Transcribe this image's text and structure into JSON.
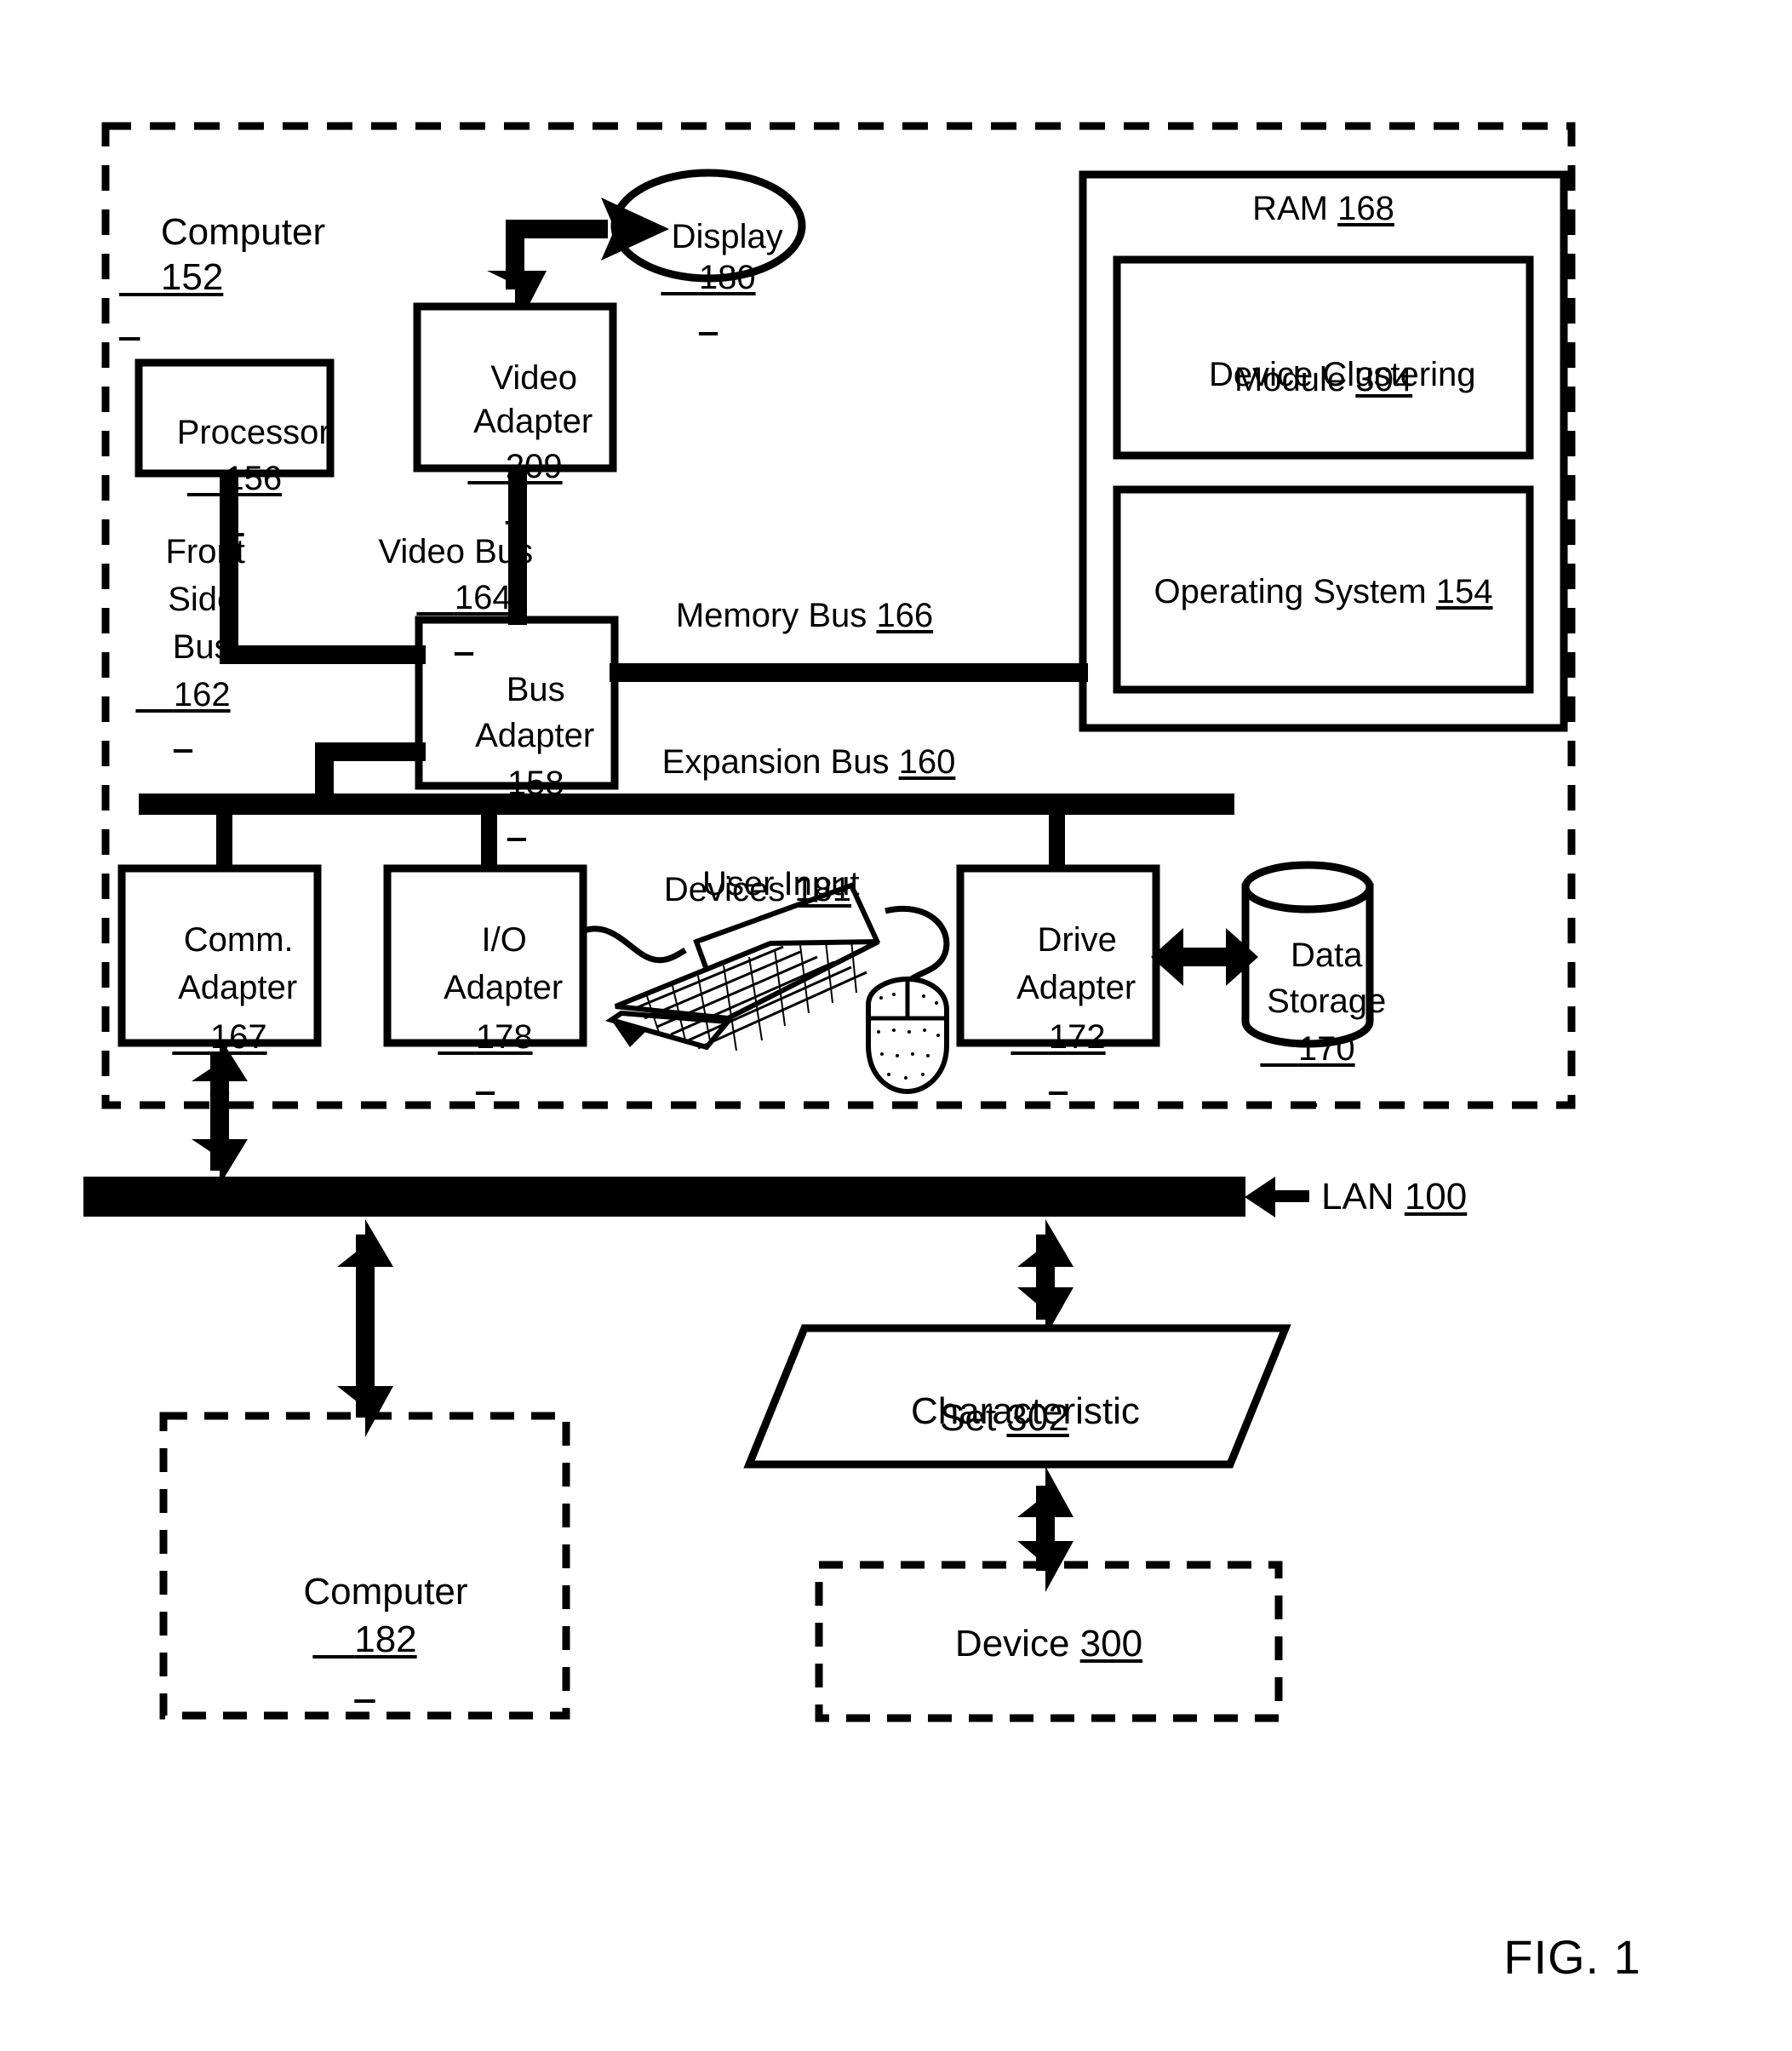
{
  "figure": {
    "caption": "FIG. 1"
  },
  "computer_boundary": {
    "title": "Computer",
    "ref": "152"
  },
  "blocks": {
    "processor": {
      "line1": "Processor",
      "ref": "156"
    },
    "video_adapter": {
      "line1": "Video",
      "line2": "Adapter",
      "ref": "209"
    },
    "display": {
      "line1": "Display",
      "ref": "180"
    },
    "bus_adapter": {
      "line1": "Bus",
      "line2": "Adapter",
      "ref": "158"
    },
    "comm_adapter": {
      "line1": "Comm.",
      "line2": "Adapter",
      "ref": "167"
    },
    "io_adapter": {
      "line1": "I/O",
      "line2": "Adapter",
      "ref": "178"
    },
    "drive_adapter": {
      "line1": "Drive",
      "line2": "Adapter",
      "ref": "172"
    },
    "data_storage": {
      "line1": "Data",
      "line2": "Storage",
      "ref": "170"
    },
    "ram": {
      "title": "RAM",
      "ref": "168"
    },
    "device_clustering_module": {
      "line1": "Device Clustering",
      "line2": "Module",
      "ref": "304"
    },
    "operating_system": {
      "line1": "Operating System",
      "ref": "154"
    },
    "computer_182": {
      "line1": "Computer",
      "ref": "182"
    },
    "characteristic_set": {
      "line1": "Characteristic",
      "line2": "Set",
      "ref": "302"
    },
    "device_300": {
      "line1": "Device",
      "ref": "300"
    }
  },
  "bus_labels": {
    "front_side_bus": {
      "l1": "Front",
      "l2": "Side",
      "l3": "Bus",
      "ref": "162"
    },
    "video_bus": {
      "l1": "Video Bus",
      "ref": "164"
    },
    "memory_bus": {
      "l1": "Memory Bus",
      "ref": "166"
    },
    "expansion_bus": {
      "l1": "Expansion Bus",
      "ref": "160"
    },
    "user_input_devices": {
      "l1": "User Input",
      "l2": "Devices",
      "ref": "181"
    },
    "lan": {
      "l1": "LAN",
      "ref": "100"
    }
  },
  "colors": {
    "ink": "#000000",
    "paper": "#ffffff"
  }
}
